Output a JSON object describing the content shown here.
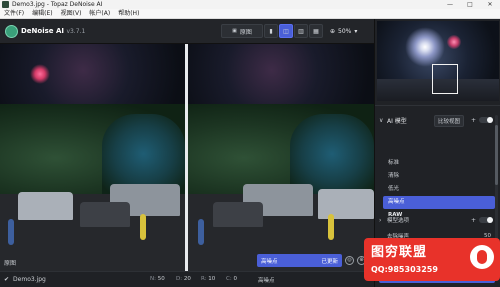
{
  "window": {
    "title": "Demo3.jpg - Topaz DeNoise AI",
    "min": "—",
    "max": "□",
    "close": "✕"
  },
  "menu": {
    "items": [
      "文件(F)",
      "编辑(E)",
      "视图(V)",
      "帐户(A)",
      "帮助(H)"
    ]
  },
  "toolbar": {
    "app_name": "DeNoise AI",
    "version": "v3.7.1",
    "original_button": "原图",
    "view_single": "▮",
    "view_split": "◫",
    "view_side": "▥",
    "view_compare": "▦",
    "zoom_icon": "⊕",
    "zoom_value": "50%",
    "zoom_menu": "▾"
  },
  "viewer": {
    "left_label": "原图",
    "popup_text": "高噪点",
    "popup_status": "已更新",
    "btn1": "◎",
    "btn2": "⊕"
  },
  "statusbar": {
    "check": "✔",
    "filename": "Demo3.jpg",
    "n_label": "N:",
    "n_value": "50",
    "d_label": "D:",
    "d_value": "20",
    "r_label": "R:",
    "r_value": "10",
    "c_label": "C:",
    "c_value": "0",
    "mode": "高噪点"
  },
  "panel": {
    "ai_model_title": "AI 模型",
    "compare_button": "比较视图",
    "plus": "+",
    "modes": [
      "标准",
      "清除",
      "低光",
      "高噪点",
      "RAW"
    ],
    "selected_mode": "高噪点",
    "model_option_label": "模型选项",
    "noise_label": "去除噪声",
    "noise_value": "50"
  },
  "watermark": {
    "title": "图穷联盟",
    "qq": "QQ:985303259"
  },
  "colors": {
    "accent": "#4a5fd8",
    "watermark": "#e8322a"
  }
}
